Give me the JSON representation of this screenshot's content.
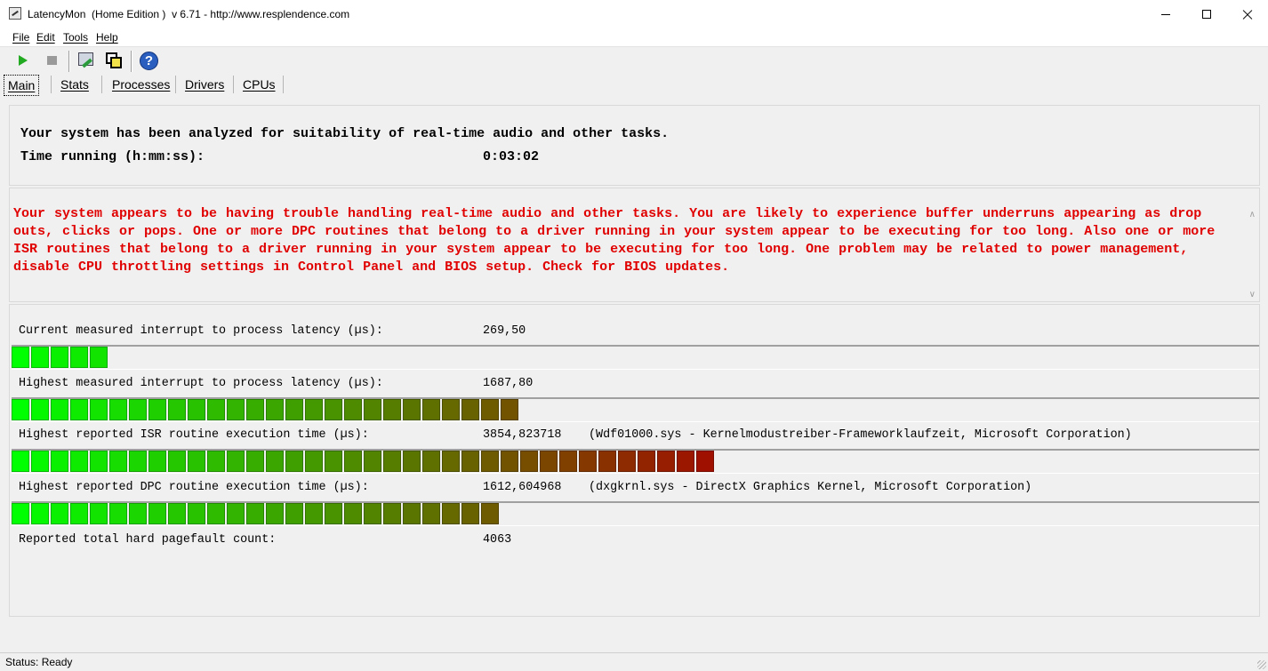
{
  "window": {
    "title": "LatencyMon  (Home Edition )  v 6.71 - http://www.resplendence.com",
    "minimize_label": "",
    "maximize_label": "",
    "close_label": ""
  },
  "menu": [
    {
      "label": "File"
    },
    {
      "label": "Edit"
    },
    {
      "label": "Tools"
    },
    {
      "label": "Help"
    }
  ],
  "toolbar": {
    "icons": [
      "play-icon",
      "stop-icon",
      "drivers-icon",
      "cpu-icon",
      "help-icon"
    ],
    "play_enabled": true,
    "stop_enabled": false
  },
  "tabs": [
    {
      "label": "Main",
      "active": true
    },
    {
      "label": "Stats",
      "active": false
    },
    {
      "label": "Processes",
      "active": false
    },
    {
      "label": "Drivers",
      "active": false
    },
    {
      "label": "CPUs",
      "active": false
    }
  ],
  "info": {
    "headline": "Your system has been analyzed for suitability of real-time audio and other tasks.",
    "time_label": "Time running (h:mm:ss):",
    "time_value": "0:03:02"
  },
  "verdict": {
    "text": "Your system appears to be having trouble handling real-time audio and other tasks. You are likely to experience buffer underruns appearing as drop outs, clicks or pops. One or more DPC routines that belong to a driver running in your system appear to be executing for too long. Also one or more ISR routines that belong to a driver running in your system appear to be executing for too long. One problem may be related to power management, disable CPU throttling settings in Control Panel and BIOS setup. Check for BIOS updates.",
    "color": "#e00000"
  },
  "meters": [
    {
      "label": "Current measured interrupt to process latency (µs):",
      "value": "269,50",
      "extra": "",
      "segments": 5,
      "level_fraction": 0.07
    },
    {
      "label": "Highest measured interrupt to process latency (µs):",
      "value": "1687,80",
      "extra": "",
      "segments": 26,
      "level_fraction": 0.4
    },
    {
      "label": "Highest reported ISR routine execution time (µs):",
      "value": "3854,823718",
      "extra": "(Wdf01000.sys - Kernelmodustreiber-Frameworklaufzeit, Microsoft Corporation)",
      "segments": 36,
      "level_fraction": 0.56
    },
    {
      "label": "Highest reported DPC routine execution time (µs):",
      "value": "1612,604968",
      "extra": "(dxgkrnl.sys - DirectX Graphics Kernel, Microsoft Corporation)",
      "segments": 25,
      "level_fraction": 0.39
    }
  ],
  "pagefault": {
    "label": "Reported total hard pagefault count:",
    "value": "4063"
  },
  "status": {
    "text": "Status: Ready"
  },
  "colors": {
    "meter_low": "#00ff00",
    "meter_high": "#a01000",
    "verdict_red": "#e00000"
  }
}
